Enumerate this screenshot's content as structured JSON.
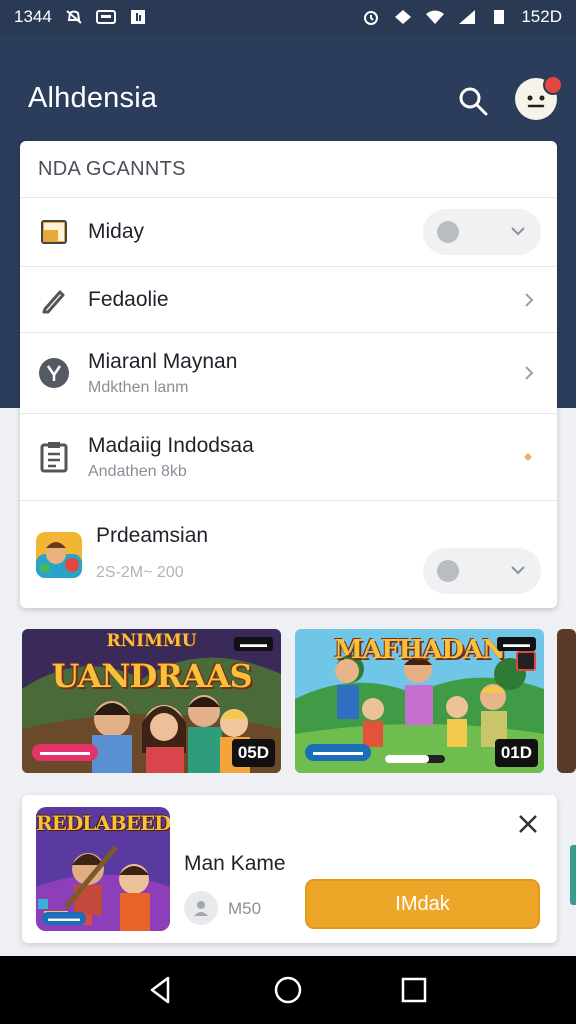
{
  "status_bar": {
    "time": "1344",
    "battery_text": "15",
    "battery_suffix": "2D"
  },
  "header": {
    "title": "Alhdensia"
  },
  "card": {
    "heading": "NDA GCANNTS",
    "items": [
      {
        "primary": "Miday",
        "secondary": "",
        "control": "toggle-dropdown"
      },
      {
        "primary": "Fedaolie",
        "secondary": "",
        "control": "chevron"
      },
      {
        "primary": "Miaranl Maynan",
        "secondary": "Mdkthen lanm",
        "control": "chevron"
      },
      {
        "primary": "Madaiig Indodsaa",
        "secondary": "Andathen 8kb",
        "control": "dot"
      },
      {
        "primary": "Prdeamsian",
        "secondary": "2S-2M~ 200",
        "control": "toggle-dropdown"
      }
    ]
  },
  "games": [
    {
      "title": "UANDRAAS",
      "subtitle": "RNIMMU",
      "duration": "05D",
      "badge": "▬▬▬",
      "tag": "▬▬▬▬▬"
    },
    {
      "title": "MAFHADAN",
      "subtitle": "",
      "duration": "01D",
      "badge": "▬▬▬",
      "tag": "▬▬▬▬▬"
    }
  ],
  "promo": {
    "art_title": "REDLABEED",
    "title": "Man Kame",
    "meta": "M50",
    "button_label": "IMdak"
  },
  "colors": {
    "header_bg": "#2c3d5c",
    "accent": "#eda628",
    "badge": "#e2483e"
  }
}
